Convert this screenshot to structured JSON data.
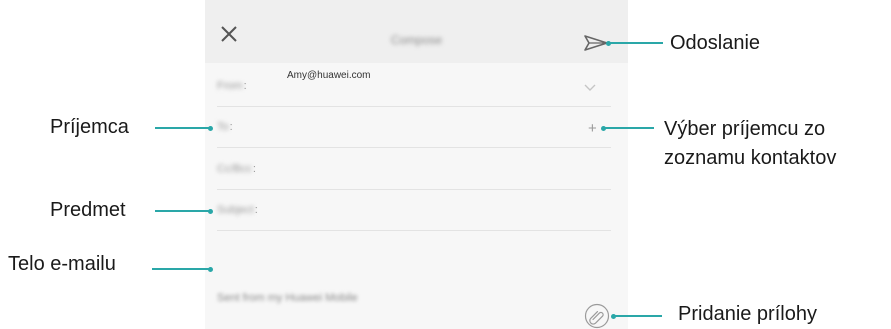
{
  "compose": {
    "title": "Compose",
    "from_label": "From",
    "from_value": "Amy@huawei.com",
    "to_label": "To",
    "ccbcc_label": "Cc/Bcc",
    "subject_label": "Subject",
    "signature": "Sent from my Huawei Mobile",
    "colon": ":"
  },
  "callouts": {
    "send": "Odoslanie",
    "recipient": "Príjemca",
    "contact_picker": [
      "Výber príjemcu zo",
      "zoznamu kontaktov"
    ],
    "subject": "Predmet",
    "body": "Telo e-mailu",
    "attachment": "Pridanie prílohy"
  },
  "colors": {
    "accent_line": "#2aa7a8",
    "toolbar_bg": "#efefef",
    "screen_bg": "#f7f7f7"
  },
  "icons": [
    "close-icon",
    "send-icon",
    "chevron-down-icon",
    "plus-icon",
    "attachment-icon"
  ]
}
